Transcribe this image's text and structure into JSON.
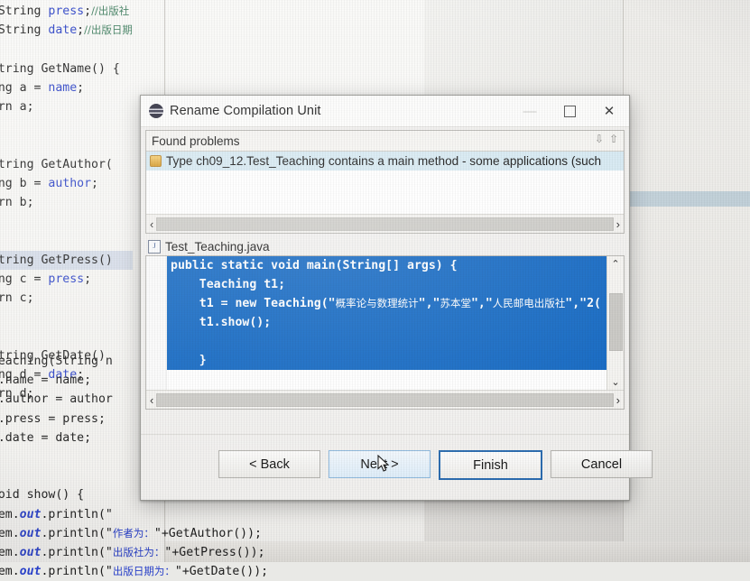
{
  "background_editor": {
    "lines": [
      {
        "indent": 0,
        "segments": [
          {
            "t": "te String ",
            "c": "plain"
          },
          {
            "t": "press",
            "c": "fld"
          },
          {
            "t": ";",
            "c": "plain"
          },
          {
            "t": "//出版社",
            "c": "cmt-cn"
          }
        ]
      },
      {
        "indent": 0,
        "segments": [
          {
            "t": "te String ",
            "c": "plain"
          },
          {
            "t": "date",
            "c": "fld"
          },
          {
            "t": ";",
            "c": "plain"
          },
          {
            "t": "//出版日期",
            "c": "cmt-cn"
          }
        ]
      },
      {
        "indent": 0,
        "segments": [
          {
            "t": "",
            "c": "plain"
          }
        ]
      },
      {
        "indent": 0,
        "segments": [
          {
            "t": "c String GetName() {",
            "c": "plain"
          }
        ]
      },
      {
        "indent": 0,
        "segments": [
          {
            "t": "tring a = ",
            "c": "plain"
          },
          {
            "t": "name",
            "c": "fld"
          },
          {
            "t": ";",
            "c": "plain"
          }
        ]
      },
      {
        "indent": 0,
        "segments": [
          {
            "t": "eturn a;",
            "c": "plain"
          }
        ]
      },
      {
        "indent": 0,
        "segments": [
          {
            "t": "",
            "c": "plain"
          }
        ]
      },
      {
        "indent": 0,
        "segments": [
          {
            "t": "",
            "c": "plain"
          }
        ]
      },
      {
        "indent": 0,
        "segments": [
          {
            "t": "c String GetAuthor(",
            "c": "plain"
          }
        ]
      },
      {
        "indent": 0,
        "segments": [
          {
            "t": "tring b = ",
            "c": "plain"
          },
          {
            "t": "author",
            "c": "fld"
          },
          {
            "t": ";",
            "c": "plain"
          }
        ]
      },
      {
        "indent": 0,
        "segments": [
          {
            "t": "eturn b;",
            "c": "plain"
          }
        ]
      },
      {
        "indent": 0,
        "segments": [
          {
            "t": "",
            "c": "plain"
          }
        ]
      },
      {
        "indent": 0,
        "segments": [
          {
            "t": "",
            "c": "plain"
          }
        ]
      },
      {
        "indent": 0,
        "segments": [
          {
            "t": "c String GetPress()",
            "c": "plain"
          }
        ],
        "selected": true
      },
      {
        "indent": 0,
        "segments": [
          {
            "t": "tring c = ",
            "c": "plain"
          },
          {
            "t": "press",
            "c": "fld"
          },
          {
            "t": ";",
            "c": "plain"
          }
        ]
      },
      {
        "indent": 0,
        "segments": [
          {
            "t": "eturn c;",
            "c": "plain"
          }
        ]
      },
      {
        "indent": 0,
        "segments": [
          {
            "t": "",
            "c": "plain"
          }
        ]
      },
      {
        "indent": 0,
        "segments": [
          {
            "t": "",
            "c": "plain"
          }
        ]
      },
      {
        "indent": 0,
        "segments": [
          {
            "t": "c String GetDate()",
            "c": "plain"
          }
        ]
      },
      {
        "indent": 0,
        "segments": [
          {
            "t": "tring d = ",
            "c": "plain"
          },
          {
            "t": "date",
            "c": "fld"
          },
          {
            "t": ";",
            "c": "plain"
          }
        ]
      },
      {
        "indent": 0,
        "segments": [
          {
            "t": "eturn d;",
            "c": "plain"
          }
        ]
      },
      {
        "indent": 0,
        "segments": [
          {
            "t": "",
            "c": "plain"
          }
        ]
      },
      {
        "indent": 0,
        "segments": [
          {
            "t": "",
            "c": "plain"
          }
        ]
      },
      {
        "indent": 0,
        "segments": [
          {
            "t": "c Teaching(String n",
            "c": "plain"
          }
        ]
      },
      {
        "indent": 0,
        "segments": [
          {
            "t": "his",
            "c": "kw"
          },
          {
            "t": ".name = name;",
            "c": "plain"
          }
        ]
      },
      {
        "indent": 0,
        "segments": [
          {
            "t": "his",
            "c": "kw"
          },
          {
            "t": ".author = author",
            "c": "plain"
          }
        ]
      },
      {
        "indent": 0,
        "segments": [
          {
            "t": "his",
            "c": "kw"
          },
          {
            "t": ".press = press;",
            "c": "plain"
          }
        ]
      },
      {
        "indent": 0,
        "segments": [
          {
            "t": "his",
            "c": "kw"
          },
          {
            "t": ".date = date;",
            "c": "plain"
          }
        ]
      },
      {
        "indent": 0,
        "segments": [
          {
            "t": "",
            "c": "plain"
          }
        ]
      },
      {
        "indent": 0,
        "segments": [
          {
            "t": "",
            "c": "plain"
          }
        ]
      },
      {
        "indent": 0,
        "segments": [
          {
            "t": "c void show() {",
            "c": "plain"
          }
        ]
      },
      {
        "indent": 0,
        "segments": [
          {
            "t": "ystem.",
            "c": "plain"
          },
          {
            "t": "out",
            "c": "ital"
          },
          {
            "t": ".println(\"",
            "c": "plain"
          }
        ]
      },
      {
        "indent": 0,
        "segments": [
          {
            "t": "ystem.",
            "c": "plain"
          },
          {
            "t": "out",
            "c": "ital"
          },
          {
            "t": ".println(\"",
            "c": "plain"
          },
          {
            "t": "作者为：",
            "c": "str-cn"
          },
          {
            "t": "\"+GetAuthor());",
            "c": "plain"
          }
        ]
      },
      {
        "indent": 0,
        "segments": [
          {
            "t": "ystem.",
            "c": "plain"
          },
          {
            "t": "out",
            "c": "ital"
          },
          {
            "t": ".println(\"",
            "c": "plain"
          },
          {
            "t": "出版社为：",
            "c": "str-cn"
          },
          {
            "t": "\"+GetPress());",
            "c": "plain"
          }
        ]
      },
      {
        "indent": 0,
        "segments": [
          {
            "t": "ystem.",
            "c": "plain"
          },
          {
            "t": "out",
            "c": "ital"
          },
          {
            "t": ".println(\"",
            "c": "plain"
          },
          {
            "t": "出版日期为：",
            "c": "str-cn"
          },
          {
            "t": "\"+GetDate());",
            "c": "plain"
          }
        ]
      }
    ]
  },
  "dialog": {
    "title": "Rename Compilation Unit",
    "icon": "eclipse-icon",
    "window_controls": {
      "minimize": "—",
      "maximize": "□",
      "close": "✕"
    },
    "problems": {
      "header": "Found problems",
      "nav_down": "⇩",
      "nav_up": "⇧",
      "items": [
        {
          "icon": "warning-icon",
          "text": "Type ch09_12.Test_Teaching contains a main method - some applications (such"
        }
      ],
      "hscroll_left": "‹",
      "hscroll_right": "›"
    },
    "preview": {
      "file_icon": "java-file-icon",
      "file_name": "Test_Teaching.java",
      "code_lines": [
        {
          "text": "public static void main(String[] args) {",
          "highlight": true
        },
        {
          "text": "    Teaching t1;",
          "highlight": true
        },
        {
          "text": "    t1 = new Teaching(\"概率论与数理统计\",\"苏本堂\",\"人民邮电出版社\",\"2(",
          "highlight": true
        },
        {
          "text": "    t1.show();",
          "highlight": true
        },
        {
          "text": "",
          "highlight": true
        },
        {
          "text": "    }",
          "highlight": true
        },
        {
          "text": "",
          "highlight": false
        },
        {
          "text": "}",
          "highlight": false
        }
      ],
      "vscroll_up": "⌃",
      "vscroll_down": "⌄",
      "hscroll_left": "‹",
      "hscroll_right": "›"
    },
    "buttons": [
      {
        "label": "< Back",
        "state": "normal",
        "name": "back-button"
      },
      {
        "label": "Next >",
        "state": "hover",
        "name": "next-button"
      },
      {
        "label": "Finish",
        "state": "default",
        "name": "finish-button"
      },
      {
        "label": "Cancel",
        "state": "normal",
        "name": "cancel-button"
      }
    ]
  },
  "colors": {
    "selection_blue": "#1268c3",
    "problem_row_blue": "#d7eaf3",
    "default_button_border": "#2b6cb0",
    "right_band": "#b9cbd6"
  }
}
